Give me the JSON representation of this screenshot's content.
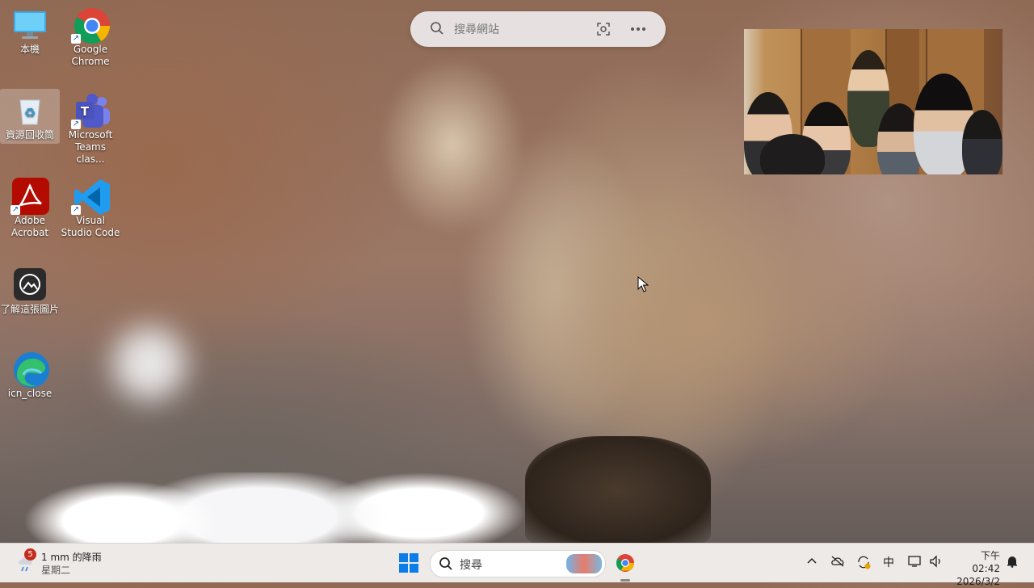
{
  "desktop": {
    "icons": [
      {
        "label": "本機"
      },
      {
        "label": "Google Chrome"
      },
      {
        "label": "資源回收筒"
      },
      {
        "label": "Microsoft Teams clas..."
      },
      {
        "label": "Adobe Acrobat"
      },
      {
        "label": "Visual Studio Code"
      },
      {
        "label": "了解這張圖片"
      },
      {
        "label": "icn_close"
      }
    ]
  },
  "web_search": {
    "placeholder": "搜尋網站"
  },
  "taskbar": {
    "weather": {
      "badge": "5",
      "line1": "1 mm 的降雨",
      "line2": "星期二"
    },
    "search_placeholder": "搜尋",
    "ime": "中",
    "clock": {
      "time": "下午 02:42",
      "date": "2026/3/2"
    }
  },
  "colors": {
    "taskbar_bg": "#eeeae8",
    "windows_blue": "#0a7de8"
  }
}
